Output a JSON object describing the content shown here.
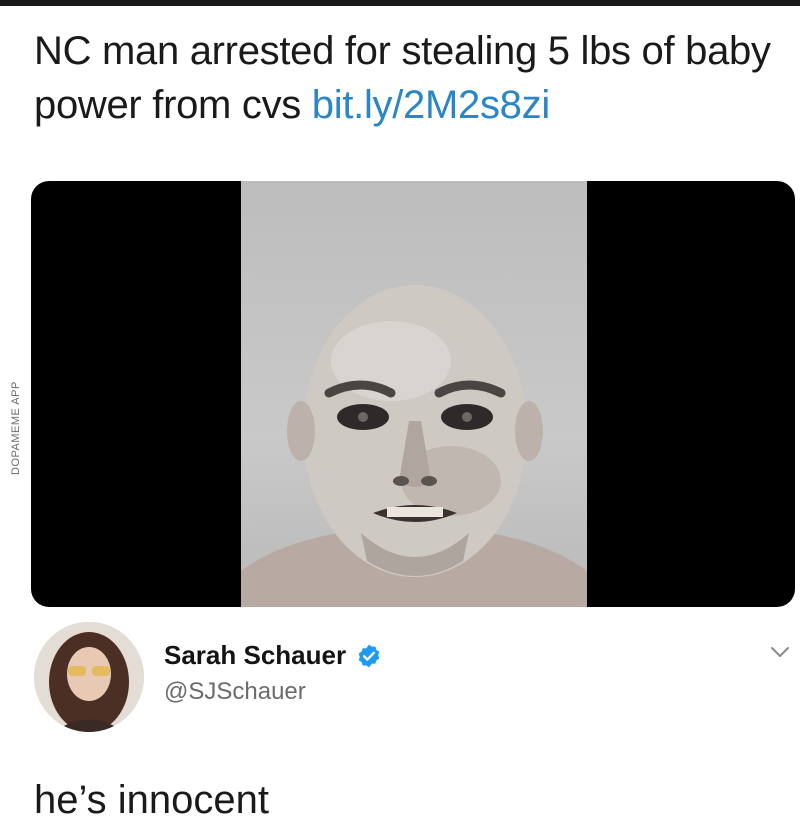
{
  "headline": {
    "text": "NC man arrested for stealing 5 lbs of baby power from cvs ",
    "link": "bit.ly/2M2s8zi"
  },
  "watermark": "DOPAMEME APP",
  "author": {
    "name": "Sarah Schauer",
    "handle": "@SJSchauer",
    "verified": true
  },
  "reply": {
    "text": "he’s innocent"
  },
  "icons": {
    "verified": "verified-badge-icon",
    "menu": "chevron-down-icon",
    "avatar": "profile-photo"
  },
  "colors": {
    "link": "#2a86c8",
    "verified": "#1d9bf0",
    "text": "#1a1a1a",
    "muted": "#6b6b6b"
  }
}
